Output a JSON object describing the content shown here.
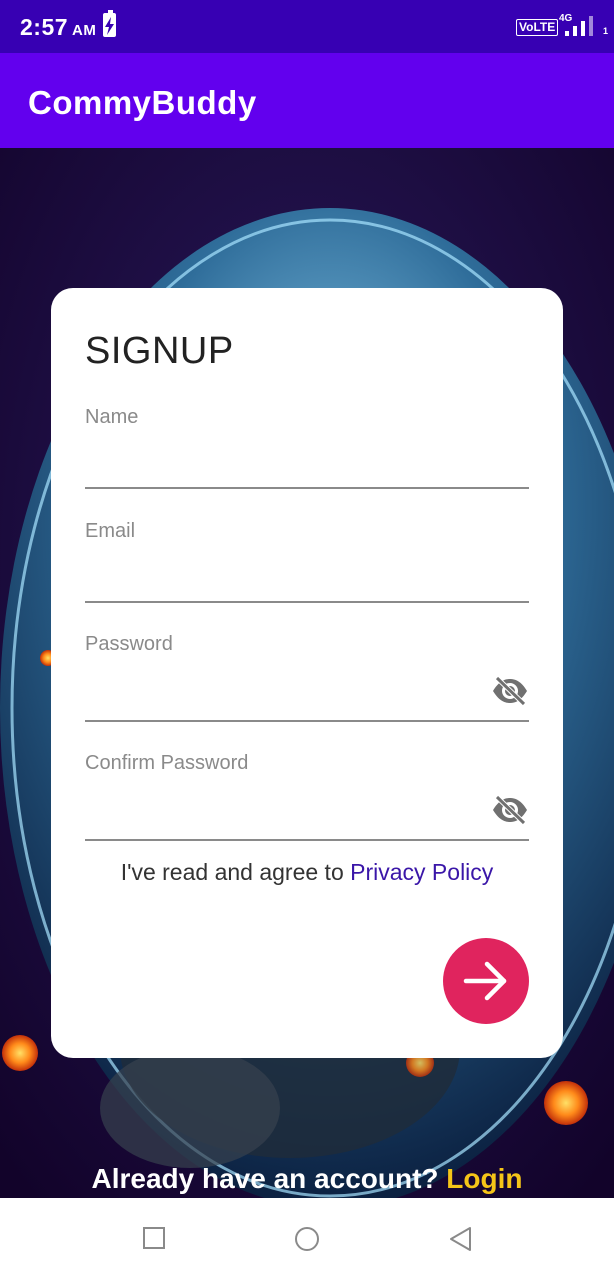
{
  "status_bar": {
    "time": "2:57",
    "ampm": "AM",
    "volte": "VoLTE",
    "network_type": "4G",
    "sim_slot": "1"
  },
  "app_bar": {
    "title": "CommyBuddy"
  },
  "signup_form": {
    "title": "SIGNUP",
    "fields": [
      {
        "label": "Name",
        "value": ""
      },
      {
        "label": "Email",
        "value": ""
      },
      {
        "label": "Password",
        "value": "",
        "toggle_icon": "eye-off-icon"
      },
      {
        "label": "Confirm Password",
        "value": "",
        "toggle_icon": "eye-off-icon"
      }
    ],
    "policy_prefix": "I've read and agree to ",
    "policy_link": "Privacy Policy",
    "submit_icon": "arrow-right-icon"
  },
  "footer": {
    "login_prompt": "Already have an account?",
    "login_link": "Login"
  },
  "nav_bar": {
    "buttons": [
      "recent-apps-icon",
      "home-icon",
      "back-icon"
    ]
  },
  "colors": {
    "status_bar": "#3700b3",
    "app_bar": "#6200ee",
    "submit_button": "#e0245e",
    "login_link": "#f5c518",
    "policy_link": "#3a16a8"
  }
}
